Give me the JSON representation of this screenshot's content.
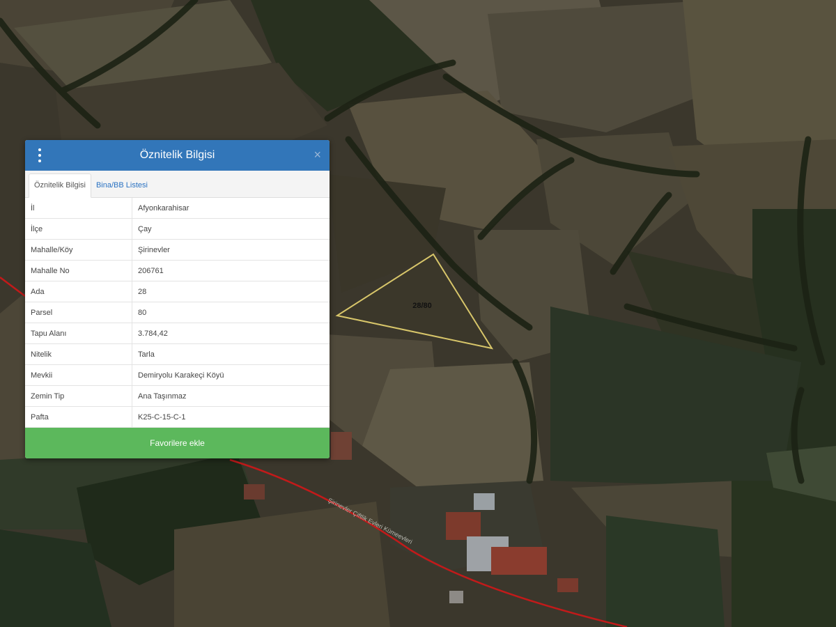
{
  "map": {
    "parcel_label": "28/80",
    "road_label": "Şirinevler Çiftlik Evleri Kümeevleri"
  },
  "panel": {
    "title": "Öznitelik Bilgisi",
    "menu_icon": "vertical-dots-icon",
    "close_icon": "close-icon",
    "close_glyph": "×",
    "tabs": [
      {
        "label": "Öznitelik Bilgisi",
        "active": true
      },
      {
        "label": "Bina/BB Listesi",
        "active": false
      }
    ],
    "rows": [
      {
        "key": "İl",
        "value": "Afyonkarahisar"
      },
      {
        "key": "İlçe",
        "value": "Çay"
      },
      {
        "key": "Mahalle/Köy",
        "value": "Şirinevler"
      },
      {
        "key": "Mahalle No",
        "value": "206761"
      },
      {
        "key": "Ada",
        "value": "28"
      },
      {
        "key": "Parsel",
        "value": "80"
      },
      {
        "key": "Tapu Alanı",
        "value": "3.784,42"
      },
      {
        "key": "Nitelik",
        "value": "Tarla"
      },
      {
        "key": "Mevkii",
        "value": "Demiryolu Karakeçi Köyü"
      },
      {
        "key": "Zemin Tip",
        "value": "Ana Taşınmaz"
      },
      {
        "key": "Pafta",
        "value": "K25-C-15-C-1"
      }
    ],
    "favorite_button": "Favorilere ekle"
  },
  "colors": {
    "header": "#3276b9",
    "button": "#5cb85c",
    "parcel_outline": "#d8c66a",
    "road": "#c21a1a"
  }
}
